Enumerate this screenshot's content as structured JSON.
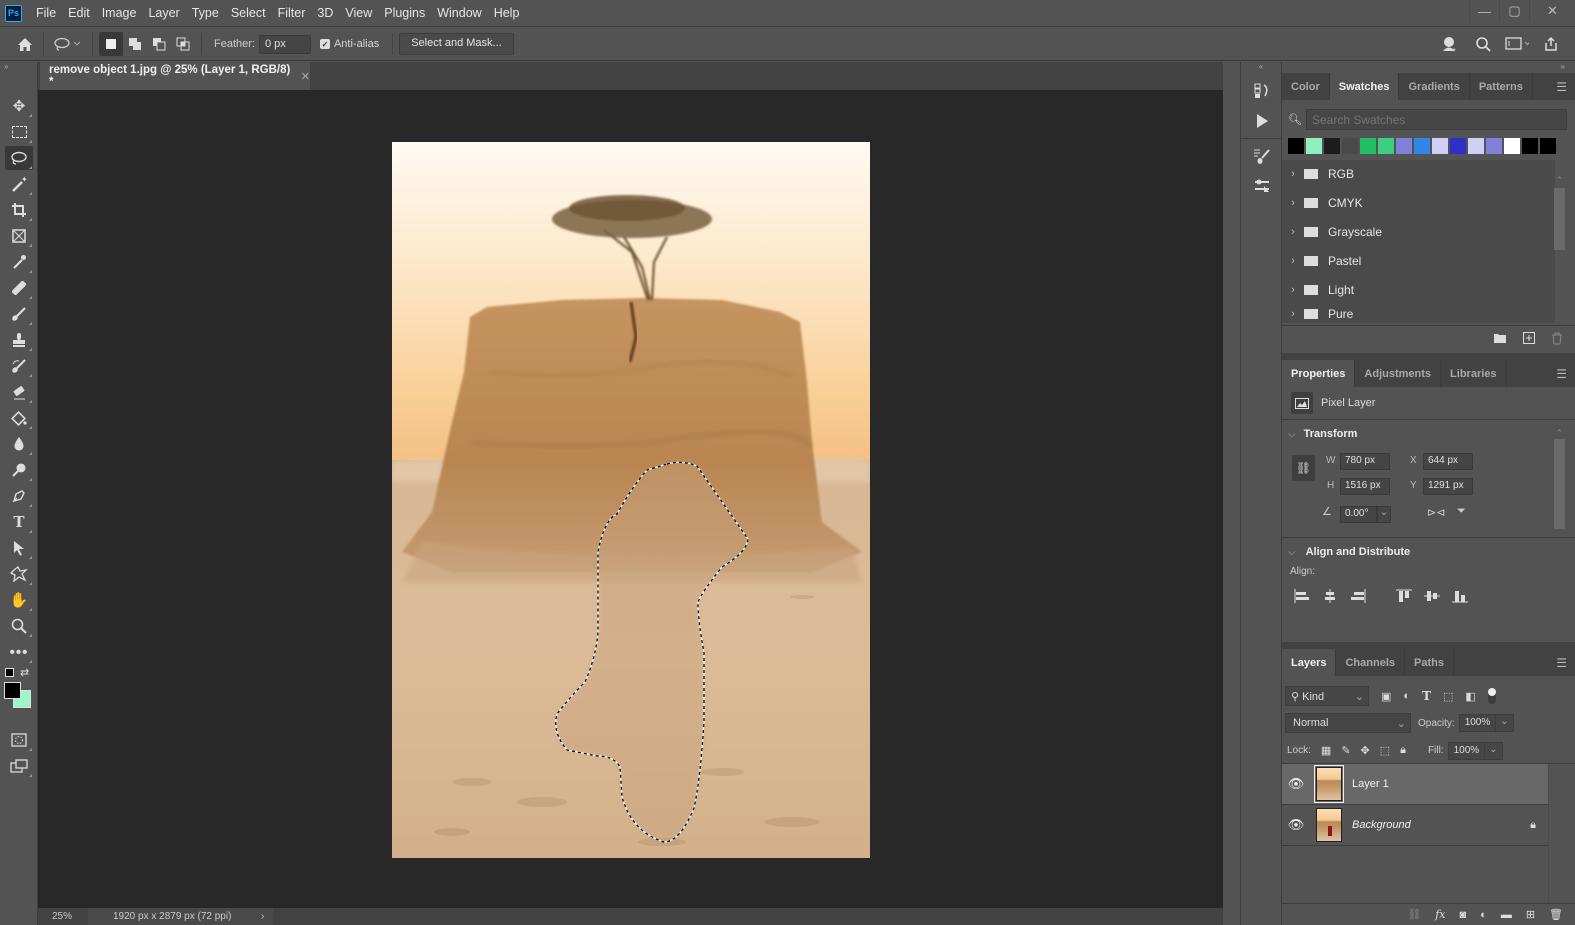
{
  "app": {
    "logo": "Ps"
  },
  "menubar": {
    "items": [
      "File",
      "Edit",
      "Image",
      "Layer",
      "Type",
      "Select",
      "Filter",
      "3D",
      "View",
      "Plugins",
      "Window",
      "Help"
    ]
  },
  "window_controls": {
    "minimize": "—",
    "maximize": "▢",
    "close": "✕"
  },
  "options_bar": {
    "feather_label": "Feather:",
    "feather_value": "0 px",
    "antialias_label": "Anti-alias",
    "antialias_checked": true,
    "select_mask_label": "Select and Mask..."
  },
  "document": {
    "tab_title": "remove object 1.jpg @ 25% (Layer 1, RGB/8) *",
    "zoom": "25%",
    "info": "1920 px x 2879 px (72 ppi)"
  },
  "tools": [
    "move",
    "rectangular-marquee",
    "lasso",
    "magic-wand",
    "crop",
    "frame",
    "eyedropper",
    "healing-brush",
    "brush",
    "clone-stamp",
    "history-brush",
    "eraser",
    "paint-bucket",
    "blur",
    "dodge",
    "pen",
    "type",
    "path-selection",
    "custom-shape",
    "hand",
    "zoom",
    "more"
  ],
  "colors": {
    "foreground": "#000000",
    "background": "#9ef5c8",
    "accent_highlight": "#686868"
  },
  "swatches_panel": {
    "tabs": [
      "Color",
      "Swatches",
      "Gradients",
      "Patterns"
    ],
    "active_tab": "Swatches",
    "search_placeholder": "Search Swatches",
    "recent_swatches": [
      "#000000",
      "#8ef0c0",
      "#1c1c1c",
      "#4a4a4a",
      "#22c065",
      "#3ccf80",
      "#8080d8",
      "#2f86e8",
      "#d0d0f5",
      "#3030c8",
      "#d0d0f5",
      "#8080d8",
      "#ffffff",
      "#000000",
      "#000000"
    ],
    "groups": [
      "RGB",
      "CMYK",
      "Grayscale",
      "Pastel",
      "Light",
      "Pure"
    ]
  },
  "properties_panel": {
    "tabs": [
      "Properties",
      "Adjustments",
      "Libraries"
    ],
    "active_tab": "Properties",
    "layer_type": "Pixel Layer",
    "transform_label": "Transform",
    "w_label": "W",
    "w_value": "780 px",
    "h_label": "H",
    "h_value": "1516 px",
    "x_label": "X",
    "x_value": "644 px",
    "y_label": "Y",
    "y_value": "1291 px",
    "angle_value": "0.00°",
    "align_section": "Align and Distribute",
    "align_label": "Align:"
  },
  "layers_panel": {
    "tabs": [
      "Layers",
      "Channels",
      "Paths"
    ],
    "active_tab": "Layers",
    "filter_kind": "Kind",
    "blend_mode": "Normal",
    "opacity_label": "Opacity:",
    "opacity_value": "100%",
    "lock_label": "Lock:",
    "fill_label": "Fill:",
    "fill_value": "100%",
    "layers": [
      {
        "name": "Layer 1",
        "visible": true,
        "selected": true,
        "locked": false
      },
      {
        "name": "Background",
        "visible": true,
        "selected": false,
        "locked": true
      }
    ]
  }
}
